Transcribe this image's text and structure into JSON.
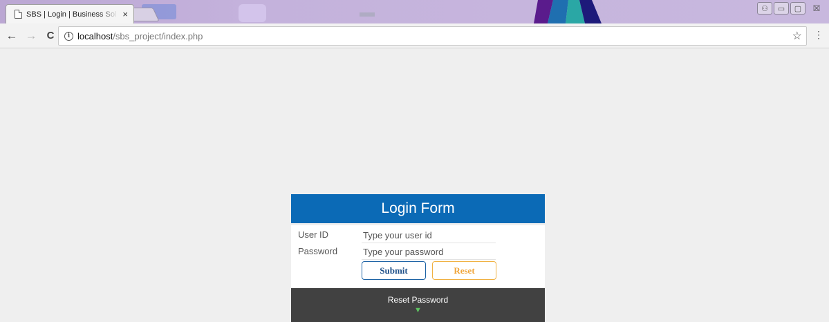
{
  "browser": {
    "tab_title": "SBS | Login | Business Sol",
    "tab_close": "×",
    "url_host": "localhost",
    "url_path": "/sbs_project/index.php",
    "icons": {
      "back": "←",
      "forward": "→",
      "reload": "C",
      "info": "i",
      "star": "☆",
      "menu": "⋮",
      "win_user": "⚇",
      "win_min": "▭",
      "win_max": "▢",
      "win_close": "☒"
    }
  },
  "login": {
    "title": "Login Form",
    "user_label": "User ID",
    "user_placeholder": "Type your user id",
    "password_label": "Password",
    "password_placeholder": "Type your password",
    "submit_label": "Submit",
    "reset_label": "Reset",
    "reset_password_label": "Reset Password",
    "reset_password_arrow": "▼"
  },
  "colors": {
    "header_blue": "#0b6ab6",
    "submit_border": "#1d63a5",
    "reset_border": "#f0b142",
    "footer_dark": "#414141",
    "arrow_green": "#5ec461",
    "page_bg": "#efefef"
  }
}
